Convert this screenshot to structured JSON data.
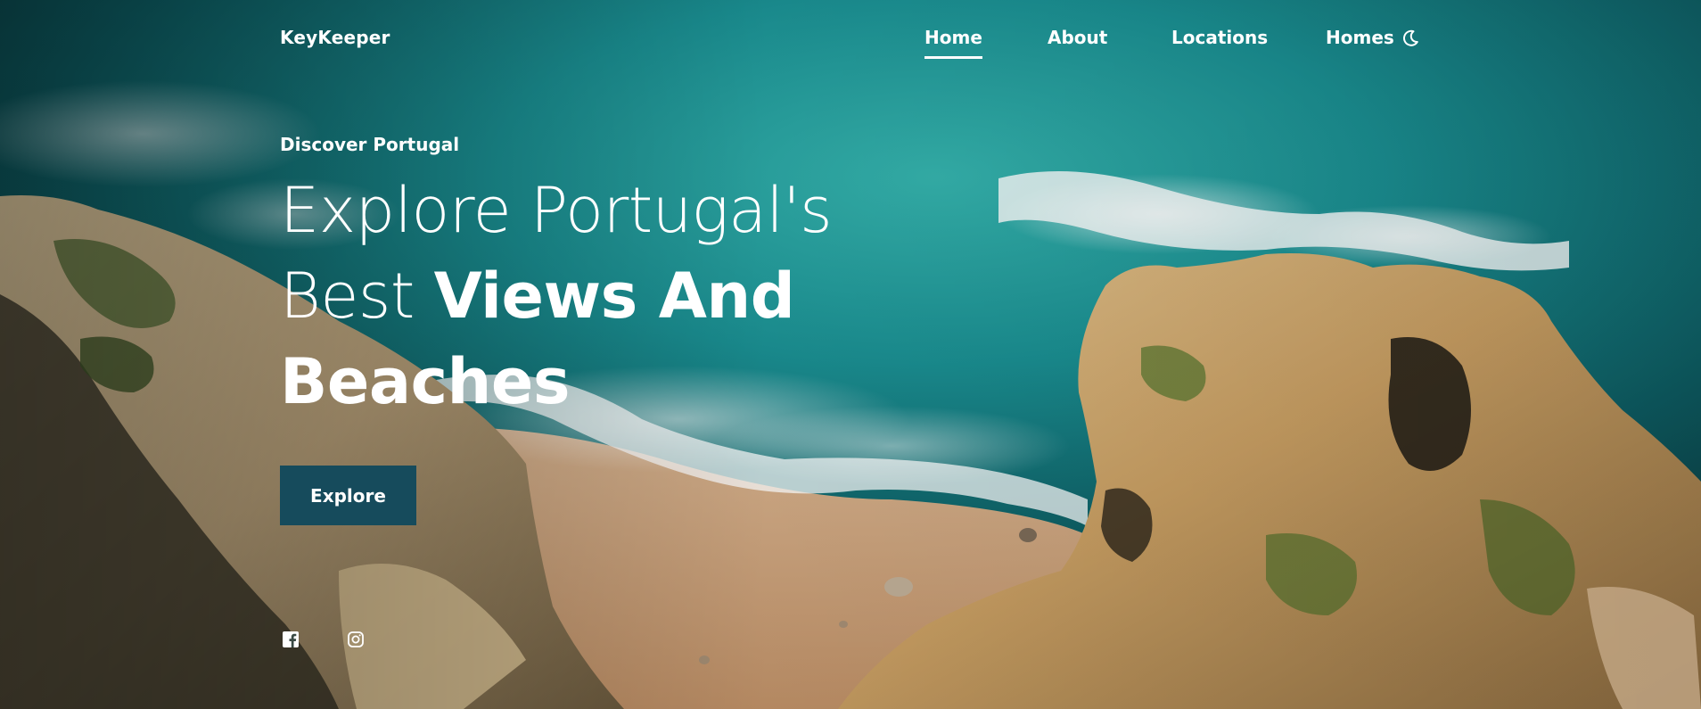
{
  "nav": {
    "brand": "KeyKeeper",
    "links": [
      {
        "label": "Home",
        "active": true
      },
      {
        "label": "About",
        "active": false
      },
      {
        "label": "Locations",
        "active": false
      },
      {
        "label": "Homes",
        "active": false
      }
    ],
    "theme_toggle_icon": "moon-icon"
  },
  "hero": {
    "subtitle": "Discover Portugal",
    "title_light_1": "Explore Portugal's",
    "title_light_2": "Best",
    "title_bold_1": "Views And",
    "title_bold_2": "Beaches",
    "cta_label": "Explore",
    "cta_color": "#164b5c"
  },
  "social": {
    "icons": [
      "facebook-icon",
      "instagram-icon"
    ]
  },
  "background": {
    "description_colors": {
      "ocean_deep": "#0e5a5e",
      "ocean_turquoise": "#1f9a9b",
      "sand": "#c9a07a",
      "cliff": "#c8a878"
    }
  }
}
